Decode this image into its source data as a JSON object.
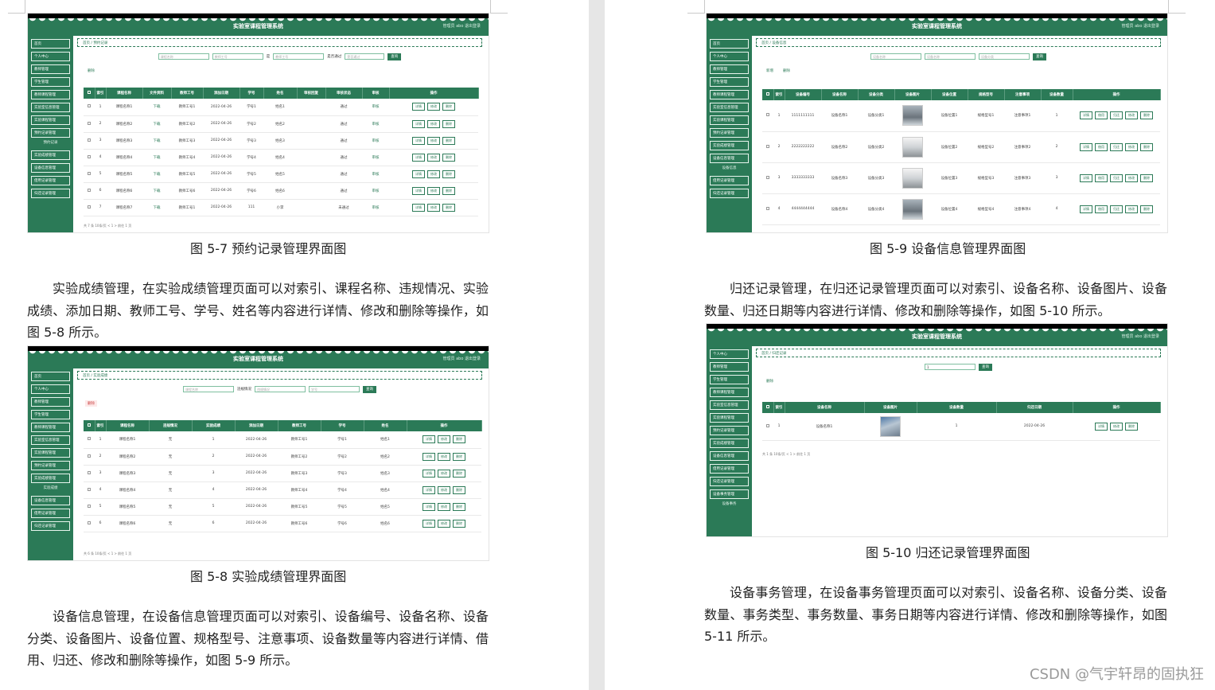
{
  "system_title": "实验室课程管理系统",
  "user_info": "管理员 abo    退出登录",
  "breadcrumb_home": "首页",
  "left_page": {
    "fig7": {
      "breadcrumb": "首页 / 预约记录",
      "search": [
        {
          "placeholder": "课程名称"
        },
        {
          "placeholder": "教师工号"
        },
        {
          "label": "是",
          "placeholder": "教师工号"
        },
        {
          "label": "是否通过",
          "placeholder": "是否通过"
        }
      ],
      "search_button": "查询",
      "delete_button": "删除",
      "columns": [
        "",
        "索引",
        "课程名称",
        "文件资料",
        "教师工号",
        "添加日期",
        "学号",
        "姓名",
        "审核回复",
        "审核状态",
        "审核",
        "操作"
      ],
      "rows": [
        [
          "1",
          "课程名称1",
          "下载",
          "教师工号1",
          "2022-04-26",
          "学号1",
          "姓名1",
          "",
          "通过",
          "审核"
        ],
        [
          "2",
          "课程名称2",
          "下载",
          "教师工号2",
          "2022-04-26",
          "学号2",
          "姓名2",
          "",
          "通过",
          "审核"
        ],
        [
          "3",
          "课程名称3",
          "下载",
          "教师工号3",
          "2022-04-26",
          "学号3",
          "姓名3",
          "",
          "通过",
          "审核"
        ],
        [
          "4",
          "课程名称4",
          "下载",
          "教师工号4",
          "2022-04-26",
          "学号4",
          "姓名4",
          "",
          "通过",
          "审核"
        ],
        [
          "5",
          "课程名称5",
          "下载",
          "教师工号5",
          "2022-04-26",
          "学号5",
          "姓名5",
          "",
          "通过",
          "审核"
        ],
        [
          "6",
          "课程名称6",
          "下载",
          "教师工号6",
          "2022-04-26",
          "学号6",
          "姓名6",
          "",
          "通过",
          "审核"
        ],
        [
          "7",
          "课程名称7",
          "下载",
          "教师工号1",
          "2022-04-26",
          "111",
          "小李",
          "",
          "未通过",
          "审核"
        ]
      ],
      "ops": [
        "详情",
        "修改",
        "删除"
      ],
      "sidebar": [
        "首页",
        "个人中心",
        "教师管理",
        "学生管理",
        "教师课程管理",
        "实验室信息管理",
        "实验课程管理",
        "预约记录管理",
        "预约记录",
        "实验成绩管理",
        "设备信息管理",
        "借用记录管理",
        "归还记录管理"
      ],
      "pager": "共 7 条   10条/页   <   1   >   前往   1   页"
    },
    "caption7": "图 5-7 预约记录管理界面图",
    "para1": "实验成绩管理，在实验成绩管理页面可以对索引、课程名称、违规情况、实验成绩、添加日期、教师工号、学号、姓名等内容进行详情、修改和删除等操作，如图 5-8 所示。",
    "fig8": {
      "breadcrumb": "首页 / 实验成绩",
      "search": [
        {
          "placeholder": "课程名称"
        },
        {
          "label": "违规情况",
          "placeholder": "违规情况"
        },
        {
          "placeholder": "学号"
        }
      ],
      "search_button": "查询",
      "delete_button": "删除",
      "columns": [
        "",
        "索引",
        "课程名称",
        "违规情况",
        "实验成绩",
        "添加日期",
        "教师工号",
        "学号",
        "姓名",
        "操作"
      ],
      "rows": [
        [
          "1",
          "课程名称1",
          "无",
          "1",
          "2022-04-26",
          "教师工号1",
          "学号1",
          "姓名1"
        ],
        [
          "2",
          "课程名称2",
          "无",
          "2",
          "2022-04-26",
          "教师工号2",
          "学号2",
          "姓名2"
        ],
        [
          "3",
          "课程名称3",
          "无",
          "3",
          "2022-04-26",
          "教师工号3",
          "学号3",
          "姓名3"
        ],
        [
          "4",
          "课程名称4",
          "无",
          "4",
          "2022-04-26",
          "教师工号4",
          "学号4",
          "姓名4"
        ],
        [
          "5",
          "课程名称5",
          "无",
          "5",
          "2022-04-26",
          "教师工号5",
          "学号5",
          "姓名5"
        ],
        [
          "6",
          "课程名称6",
          "无",
          "6",
          "2022-04-26",
          "教师工号6",
          "学号6",
          "姓名6"
        ]
      ],
      "ops": [
        "详情",
        "修改",
        "删除"
      ],
      "sidebar": [
        "首页",
        "个人中心",
        "教师管理",
        "学生管理",
        "教师课程管理",
        "实验室信息管理",
        "实验课程管理",
        "预约记录管理",
        "实验成绩管理",
        "实验成绩",
        "设备信息管理",
        "借用记录管理",
        "归还记录管理"
      ],
      "pager": "共 6 条   10条/页   <   1   >   前往   1   页"
    },
    "caption8": "图 5-8 实验成绩管理界面图",
    "para2": "设备信息管理，在设备信息管理页面可以对索引、设备编号、设备名称、设备分类、设备图片、设备位置、规格型号、注意事项、设备数量等内容进行详情、借用、归还、修改和删除等操作，如图 5-9 所示。"
  },
  "right_page": {
    "fig9": {
      "breadcrumb": "首页 / 设备信息",
      "search": [
        {
          "placeholder": "设备名称"
        },
        {
          "placeholder": "设备名称"
        },
        {
          "placeholder": "设备分类"
        }
      ],
      "search_button": "查询",
      "add_button": "新增",
      "delete_button": "删除",
      "columns": [
        "",
        "索引",
        "设备编号",
        "设备名称",
        "设备分类",
        "设备图片",
        "设备位置",
        "规格型号",
        "注意事项",
        "设备数量",
        "操作"
      ],
      "rows": [
        [
          "1",
          "1111111111",
          "设备名称1",
          "设备分类1",
          "",
          "设备位置1",
          "规格型号1",
          "注意事项1",
          "1"
        ],
        [
          "2",
          "2222222222",
          "设备名称2",
          "设备分类2",
          "",
          "设备位置2",
          "规格型号2",
          "注意事项2",
          "2"
        ],
        [
          "3",
          "3333333333",
          "设备名称3",
          "设备分类3",
          "",
          "设备位置3",
          "规格型号3",
          "注意事项3",
          "3"
        ],
        [
          "4",
          "4444444444",
          "设备名称4",
          "设备分类4",
          "",
          "设备位置4",
          "规格型号4",
          "注意事项4",
          "4"
        ]
      ],
      "ops": [
        "详情",
        "借用",
        "归还",
        "修改",
        "删除"
      ],
      "sidebar": [
        "首页",
        "个人中心",
        "教师管理",
        "学生管理",
        "教师课程管理",
        "实验室信息管理",
        "实验课程管理",
        "预约记录管理",
        "实验成绩管理",
        "设备信息管理",
        "设备信息",
        "借用记录管理",
        "归还记录管理"
      ]
    },
    "caption9": "图 5-9 设备信息管理界面图",
    "para3": "归还记录管理，在归还记录管理页面可以对索引、设备名称、设备图片、设备数量、归还日期等内容进行详情、修改和删除等操作，如图 5-10 所示。",
    "fig10": {
      "breadcrumb": "首页 / 归还记录",
      "search_value": "1",
      "search_button": "查询",
      "delete_button": "删除",
      "columns": [
        "",
        "索引",
        "设备名称",
        "设备图片",
        "设备数量",
        "归还日期",
        "操作"
      ],
      "rows": [
        [
          "1",
          "设备名称1",
          "",
          "1",
          "2022-04-26"
        ]
      ],
      "ops": [
        "详情",
        "修改",
        "删除"
      ],
      "sidebar": [
        "个人中心",
        "教师管理",
        "学生管理",
        "教师课程管理",
        "实验室信息管理",
        "实验课程管理",
        "预约记录管理",
        "实验成绩管理",
        "设备信息管理",
        "借用记录管理",
        "归还记录管理",
        "设备事务管理",
        "设备事务"
      ],
      "pager": "共 1 条   10条/页   <   1   >   前往   1   页"
    },
    "caption10": "图 5-10 归还记录管理界面图",
    "para4": "设备事务管理，在设备事务管理页面可以对索引、设备名称、设备分类、设备数量、事务类型、事务数量、事务日期等内容进行详情、修改和删除等操作，如图 5-11 所示。"
  },
  "watermark": "CSDN @气宇轩昂的固执狂",
  "colors": {
    "theme_green": "#2b7a57",
    "page_gutter": "#e6e6e6"
  }
}
